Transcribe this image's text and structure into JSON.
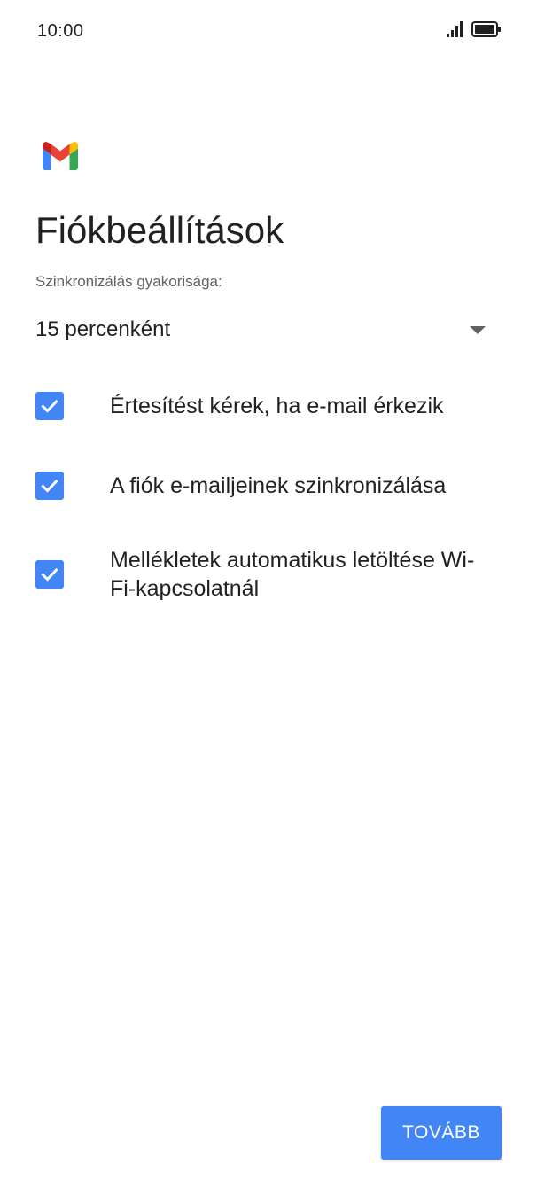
{
  "status_bar": {
    "time": "10:00",
    "signal_icon": "signal-icon",
    "battery_icon": "battery-icon"
  },
  "app": {
    "logo_icon": "gmail-icon"
  },
  "page": {
    "title": "Fiókbeállítások",
    "sync_label": "Szinkronizálás gyakorisága:",
    "sync_value": "15 percenként"
  },
  "options": [
    {
      "label": "Értesítést kérek, ha e-mail érkezik",
      "checked": true
    },
    {
      "label": "A fiók e-mailjeinek szinkronizálása",
      "checked": true
    },
    {
      "label": "Mellékletek automatikus letöltése Wi-Fi-kapcsolatnál",
      "checked": true
    }
  ],
  "actions": {
    "next_label": "TOVÁBB"
  },
  "colors": {
    "accent": "#4285f4",
    "text": "#202124",
    "secondary_text": "#5f6368"
  }
}
